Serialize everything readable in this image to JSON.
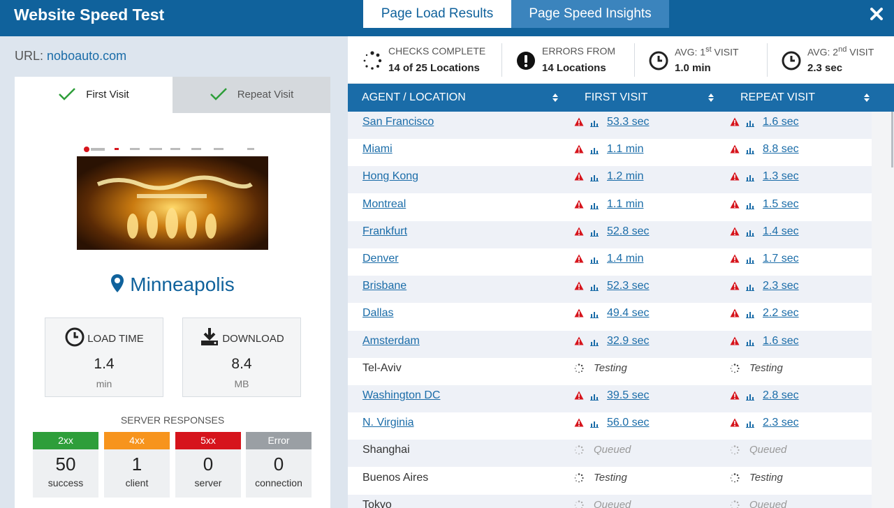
{
  "header": {
    "title": "Website Speed Test",
    "tabs": [
      {
        "label": "Page Load Results",
        "active": true
      },
      {
        "label": "Page Speed Insights",
        "active": false
      }
    ],
    "close_icon": "close-icon"
  },
  "left": {
    "url_label": "URL:",
    "url_value": "noboauto.com",
    "visit_tabs": [
      {
        "label": "First Visit",
        "icon": "check-icon"
      },
      {
        "label": "Repeat Visit",
        "icon": "check-icon"
      }
    ],
    "location": "Minneapolis",
    "load_time": {
      "label": "LOAD TIME",
      "value": "1.4",
      "unit": "min"
    },
    "download": {
      "label": "DOWNLOAD",
      "value": "8.4",
      "unit": "MB"
    },
    "server_responses": {
      "title": "SERVER RESPONSES",
      "items": [
        {
          "code": "2xx",
          "count": "50",
          "desc": "success",
          "color": "#2e9e3a"
        },
        {
          "code": "4xx",
          "count": "1",
          "desc": "client",
          "color": "#f7941d"
        },
        {
          "code": "5xx",
          "count": "0",
          "desc": "server",
          "color": "#d6141c"
        },
        {
          "code": "Error",
          "count": "0",
          "desc": "connection",
          "color": "#9a9fa4"
        }
      ]
    }
  },
  "summary": {
    "checks": {
      "label": "CHECKS COMPLETE",
      "value": "14 of 25 Locations"
    },
    "errors": {
      "label": "ERRORS FROM",
      "value": "14 Locations"
    },
    "avg_first": {
      "label": "AVG: 1",
      "sup": "st",
      "label2": "VISIT",
      "value": "1.0 min"
    },
    "avg_repeat": {
      "label": "AVG: 2",
      "sup": "nd",
      "label2": "VISIT",
      "value": "2.3 sec"
    }
  },
  "table": {
    "columns": [
      "AGENT / LOCATION",
      "FIRST VISIT",
      "REPEAT VISIT"
    ],
    "rows": [
      {
        "location": "San Francisco",
        "first": "53.3 sec",
        "repeat": "1.6 sec",
        "state": "done"
      },
      {
        "location": "Miami",
        "first": "1.1 min",
        "repeat": "8.8 sec",
        "state": "done"
      },
      {
        "location": "Hong Kong",
        "first": "1.2 min",
        "repeat": "1.3 sec",
        "state": "done"
      },
      {
        "location": "Montreal",
        "first": "1.1 min",
        "repeat": "1.5 sec",
        "state": "done"
      },
      {
        "location": "Frankfurt",
        "first": "52.8 sec",
        "repeat": "1.4 sec",
        "state": "done"
      },
      {
        "location": "Denver",
        "first": "1.4 min",
        "repeat": "1.7 sec",
        "state": "done"
      },
      {
        "location": "Brisbane",
        "first": "52.3 sec",
        "repeat": "2.3 sec",
        "state": "done"
      },
      {
        "location": "Dallas",
        "first": "49.4 sec",
        "repeat": "2.2 sec",
        "state": "done"
      },
      {
        "location": "Amsterdam",
        "first": "32.9 sec",
        "repeat": "1.6 sec",
        "state": "done"
      },
      {
        "location": "Tel-Aviv",
        "first": "Testing",
        "repeat": "Testing",
        "state": "testing"
      },
      {
        "location": "Washington DC",
        "first": "39.5 sec",
        "repeat": "2.8 sec",
        "state": "done"
      },
      {
        "location": "N. Virginia",
        "first": "56.0 sec",
        "repeat": "2.3 sec",
        "state": "done"
      },
      {
        "location": "Shanghai",
        "first": "Queued",
        "repeat": "Queued",
        "state": "queued"
      },
      {
        "location": "Buenos Aires",
        "first": "Testing",
        "repeat": "Testing",
        "state": "testing"
      },
      {
        "location": "Tokyo",
        "first": "Queued",
        "repeat": "Queued",
        "state": "queued"
      }
    ]
  },
  "colors": {
    "brand": "#10629c",
    "table_header": "#1a6ca8",
    "link": "#1a6ca8",
    "warning": "#d6141c"
  }
}
